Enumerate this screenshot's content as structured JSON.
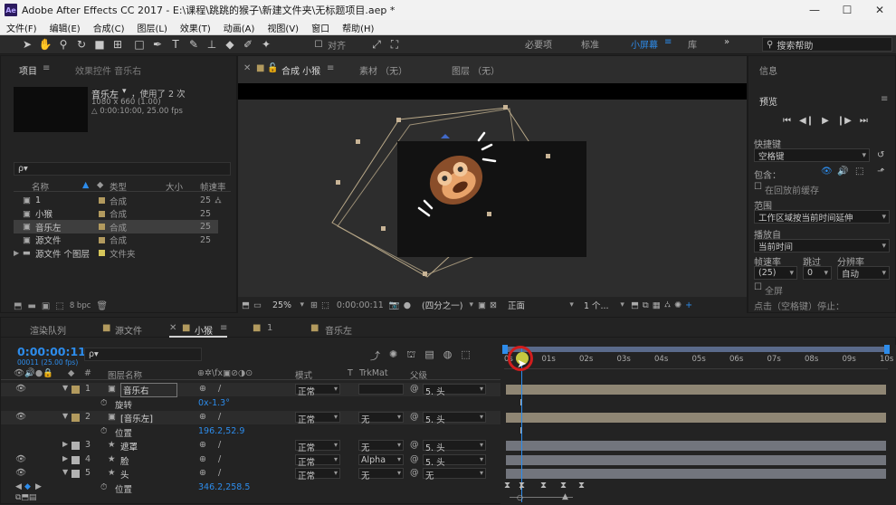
{
  "app": {
    "logo": "Ae",
    "title": "Adobe After Effects CC 2017 - E:\\课程\\跳跳的猴子\\新建文件夹\\无标题项目.aep *",
    "min": "—",
    "max": "☐",
    "close": "✕"
  },
  "menu": [
    "文件(F)",
    "编辑(E)",
    "合成(C)",
    "图层(L)",
    "效果(T)",
    "动画(A)",
    "视图(V)",
    "窗口",
    "帮助(H)"
  ],
  "toolbar": {
    "align_label": "对齐",
    "workspaces": [
      "必要项",
      "标准",
      "小屏幕",
      "库"
    ],
    "active_workspace": "小屏幕",
    "search_placeholder": "搜索帮助"
  },
  "project": {
    "tab_label": "项目",
    "fx_tab": "效果控件 音乐右",
    "item_name": "音乐左",
    "item_used": "，使用了 2 次",
    "item_size": "1080 x 660 (1.00)",
    "item_duration": "△ 0:00:10:00, 25.00 fps",
    "search_placeholder": "ρ▾",
    "columns": [
      "名称",
      "类型",
      "大小",
      "帧速率"
    ],
    "items": [
      {
        "name": "1",
        "type": "合成",
        "rate": "25"
      },
      {
        "name": "小猴",
        "type": "合成",
        "rate": "25"
      },
      {
        "name": "音乐左",
        "type": "合成",
        "rate": "25"
      },
      {
        "name": "源文件",
        "type": "合成",
        "rate": "25"
      },
      {
        "name": "源文件 个图层",
        "type": "文件夹",
        "rate": ""
      }
    ],
    "bpc": "8 bpc"
  },
  "comp": {
    "tab_label": "合成 小猴",
    "footage_tab": "素材 （无）",
    "layer_tab": "图层 （无）",
    "zoom": "25%",
    "time": "0:00:00:11",
    "res": "(四分之一)",
    "view": "正面",
    "views": "1 个..."
  },
  "info": {
    "tab_label": "信息",
    "preview_label": "预览",
    "shortcut_label": "快捷键",
    "shortcut_value": "空格键",
    "include_label": "包含：",
    "cache_label": "在回放前缓存",
    "range_label": "范围",
    "range_value": "工作区域按当前时间延伸",
    "play_from_label": "播放自",
    "play_from_value": "当前时间",
    "fps_label": "帧速率",
    "skip_label": "跳过",
    "res_label": "分辨率",
    "fps_value": "(25)",
    "skip_value": "0",
    "res_value": "自动",
    "fullscreen_label": "全屏",
    "click_label": "点击（空格键）停止："
  },
  "timeline": {
    "tabs": [
      "渲染队列",
      "源文件",
      "小猴",
      "1",
      "音乐左"
    ],
    "active_tab": "小猴",
    "current_time": "0:00:00:11",
    "frame_info": "00011 (25.00 fps)",
    "search_placeholder": "ρ▾",
    "col_headers": {
      "name": "图层名称",
      "mode": "模式",
      "t": "T",
      "trkmat": "TrkMat",
      "parent": "父级"
    },
    "ruler": [
      "0s",
      "01s",
      "02s",
      "03s",
      "04s",
      "05s",
      "06s",
      "07s",
      "08s",
      "09s",
      "10s"
    ],
    "layers": [
      {
        "num": "1",
        "name": "音乐右",
        "mode": "正常",
        "trk": "",
        "parent": "5. 头",
        "prop": "旋转",
        "prop_val": "0x-1.3°"
      },
      {
        "num": "2",
        "name": "[音乐左]",
        "mode": "正常",
        "trk": "无",
        "parent": "5. 头",
        "prop": "位置",
        "prop_val": "196.2,52.9"
      },
      {
        "num": "3",
        "name": "遮罩",
        "mode": "正常",
        "trk": "无",
        "parent": "5. 头"
      },
      {
        "num": "4",
        "name": "脸",
        "mode": "正常",
        "trk": "Alpha",
        "parent": "5. 头"
      },
      {
        "num": "5",
        "name": "头",
        "mode": "正常",
        "trk": "无",
        "parent": "无",
        "prop": "位置",
        "prop_val": "346.2,258.5"
      }
    ]
  },
  "colors": {
    "accent": "#2d8ceb",
    "layer_bar": "#8f8674",
    "layer_bar2": "#72757d",
    "playhead": "#2d8ceb"
  }
}
